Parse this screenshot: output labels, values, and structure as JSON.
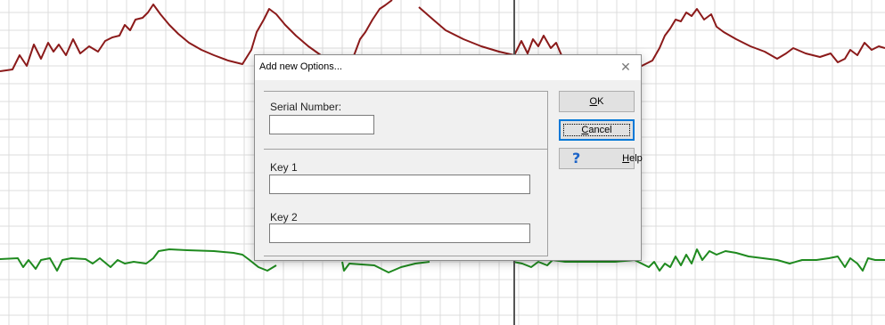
{
  "background": {
    "grid_color": "#dcdcdc",
    "trace_colors": {
      "top": "#8b1a1a",
      "bottom": "#1f8a1f",
      "cursor": "#555555"
    }
  },
  "dialog": {
    "title": "Add new Options...",
    "close_icon": "close-icon",
    "serial_label": "Serial Number:",
    "serial_value": "",
    "key1_label": "Key 1",
    "key1_value": "",
    "key2_label": "Key 2",
    "key2_value": "",
    "ok_mnemonic": "O",
    "ok_rest": "K",
    "cancel_mnemonic": "C",
    "cancel_rest": "ancel",
    "help_mnemonic": "H",
    "help_rest": "elp",
    "help_icon": "?"
  }
}
